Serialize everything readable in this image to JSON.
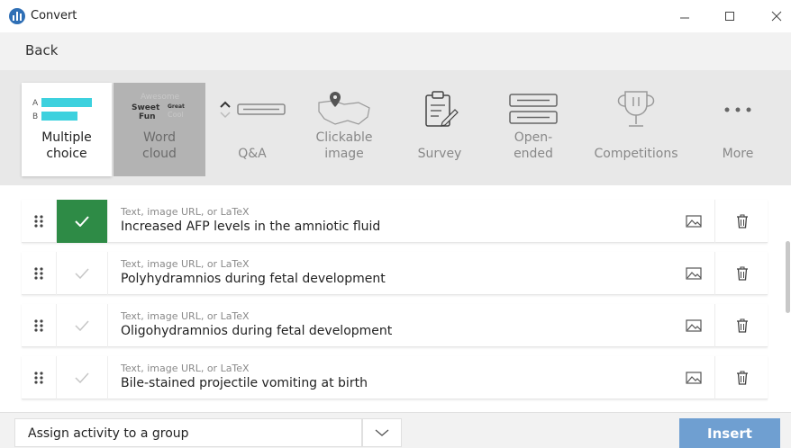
{
  "window": {
    "title": "Convert",
    "icon": "intel-logo-icon",
    "controls": [
      "minimize-icon",
      "maximize-icon",
      "close-icon"
    ]
  },
  "header": {
    "back_label": "Back"
  },
  "activity_types": [
    {
      "id": "multiple-choice",
      "label_line1": "Multiple",
      "label_line2": "choice",
      "icon": "multiple-choice-icon",
      "icon_letters": [
        "A",
        "B"
      ],
      "selected": true
    },
    {
      "id": "word-cloud",
      "label_line1": "Word",
      "label_line2": "cloud",
      "icon": "word-cloud-icon",
      "icon_words": [
        "Awesome",
        "Sweet",
        "Great",
        "Fun",
        "Cool"
      ],
      "selected": false
    },
    {
      "id": "qa",
      "label_line1": "",
      "label_line2": "Q&A",
      "icon": "qa-icon",
      "selected": false
    },
    {
      "id": "clickable-image",
      "label_line1": "Clickable",
      "label_line2": "image",
      "icon": "map-pin-icon",
      "selected": false
    },
    {
      "id": "survey",
      "label_line1": "",
      "label_line2": "Survey",
      "icon": "clipboard-icon",
      "selected": false
    },
    {
      "id": "open-ended",
      "label_line1": "Open-",
      "label_line2": "ended",
      "icon": "chat-bubbles-icon",
      "selected": false
    },
    {
      "id": "competitions",
      "label_line1": "",
      "label_line2": "Competitions",
      "icon": "trophy-icon",
      "selected": false
    },
    {
      "id": "more",
      "label_line1": "",
      "label_line2": "More",
      "icon": "more-dots-icon",
      "selected": false
    }
  ],
  "answers": [
    {
      "hint": "Text, image URL, or LaTeX",
      "text": "Increased AFP levels in the amniotic fluid",
      "correct": true
    },
    {
      "hint": "Text, image URL, or LaTeX",
      "text": "Polyhydramnios during fetal development",
      "correct": false
    },
    {
      "hint": "Text, image URL, or LaTeX",
      "text": "Oligohydramnios during fetal development",
      "correct": false
    },
    {
      "hint": "Text, image URL, or LaTeX",
      "text": "Bile-stained projectile vomiting at birth",
      "correct": false
    }
  ],
  "footer": {
    "group_label": "Assign activity to a group",
    "insert_label": "Insert"
  },
  "colors": {
    "correct_green": "#2e8b46",
    "mc_cyan": "#3dd1de",
    "insert_blue": "#6f9fd1",
    "brand_blue": "#2f6fb5"
  }
}
